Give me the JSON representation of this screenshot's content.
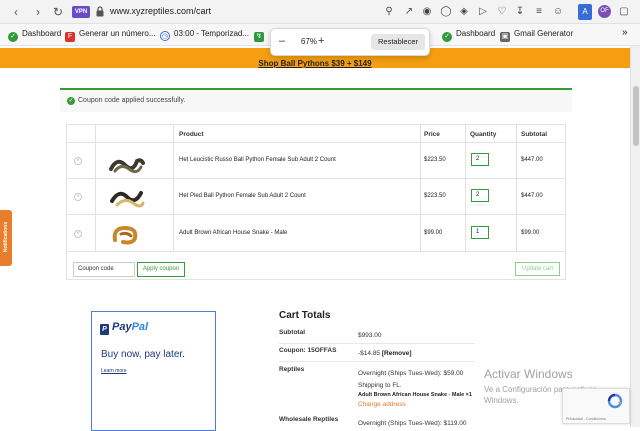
{
  "browser": {
    "vpn_label": "VPN",
    "url": "www.xyzreptiles.com/cart",
    "ext_label": "A",
    "profile_label": "OF"
  },
  "bookmarks": [
    {
      "label": "Dashboard",
      "icon": "green-circle-icon",
      "color": "#2e9a3a"
    },
    {
      "label": "Generar un número...",
      "icon": "red-f-icon",
      "color": "#d9342b"
    },
    {
      "label": "03:00 - Temporizad...",
      "icon": "clock-icon",
      "color": "#3a6cd6"
    },
    {
      "label": "Dashboard",
      "icon": "green-circle-icon",
      "color": "#2e9a3a"
    },
    {
      "label": "Gmail Generator",
      "icon": "document-icon",
      "color": "#666666"
    }
  ],
  "zoom": {
    "value": "67%",
    "minus": "–",
    "plus": "+",
    "reset_label": "Restablecer"
  },
  "banner": {
    "text": "Shop Ball Pythons $39 + $149"
  },
  "notice": {
    "text": "Coupon code applied successfully."
  },
  "cart": {
    "headers": {
      "product": "Product",
      "price": "Price",
      "quantity": "Quantity",
      "subtotal": "Subtotal"
    },
    "items": [
      {
        "name": "Het Leucistic Russo Ball Python Female Sub Adult 2 Count",
        "price": "$223.50",
        "qty": "2",
        "subtotal": "$447.00"
      },
      {
        "name": "Het Pied Ball Python Female Sub Adult 2 Count",
        "price": "$223.50",
        "qty": "2",
        "subtotal": "$447.00"
      },
      {
        "name": "Adult Brown African House Snake - Male",
        "price": "$99.00",
        "qty": "1",
        "subtotal": "$99.00"
      }
    ],
    "coupon_placeholder": "Coupon code",
    "apply_label": "Apply coupon",
    "update_label": "Update cart"
  },
  "side_tab": {
    "label": "Notifications"
  },
  "paypal": {
    "logo_pay": "Pay",
    "logo_pal": "Pal",
    "message": "Buy now, pay later.",
    "learn_more": "Learn more"
  },
  "totals": {
    "title": "Cart Totals",
    "subtotal_label": "Subtotal",
    "subtotal_value": "$993.00",
    "coupon_label": "Coupon: 15OFFAS",
    "coupon_value": "-$14.85",
    "coupon_remove": "[Remove]",
    "reptiles_label": "Reptiles",
    "reptiles_method": "Overnight (Ships Tues-Wed): $59.00",
    "shipping_to": "Shipping to FL.",
    "shipping_item": "Adult Brown African House Snake - Male ×1",
    "change_address": "Change address",
    "wholesale_label": "Wholesale Reptiles",
    "wholesale_method": "Overnight (Ships Tues-Wed): $119.00"
  },
  "windows_watermark": {
    "title": "Activar Windows",
    "line1": "Ve a Configuración para activar",
    "line2": "Windows."
  },
  "recaptcha": {
    "text": "Privacidad - Condiciones"
  }
}
